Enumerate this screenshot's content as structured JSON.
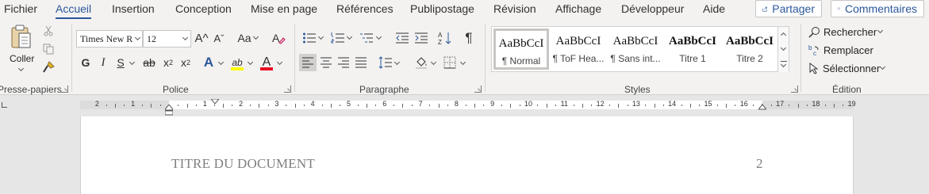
{
  "menu": {
    "tabs": [
      "Fichier",
      "Accueil",
      "Insertion",
      "Conception",
      "Mise en page",
      "Références",
      "Publipostage",
      "Révision",
      "Affichage",
      "Développeur",
      "Aide"
    ],
    "active_tab": "Accueil",
    "share_label": "Partager",
    "comments_label": "Commentaires"
  },
  "clipboard": {
    "paste_label": "Coller",
    "group_label": "Presse-papiers"
  },
  "font": {
    "family": "Times New R",
    "size": "12",
    "group_label": "Police",
    "grow_icon": "A^",
    "shrink_icon": "Aˇ",
    "case_label": "Aa",
    "bold": "G",
    "italic": "I",
    "underline": "S",
    "strike": "ab",
    "subscript": "x",
    "subscript_mark": "2",
    "superscript": "x",
    "superscript_mark": "2",
    "effects": "A",
    "highlight": "ab",
    "color": "A",
    "highlight_color": "#ffff00",
    "font_color": "#e81123"
  },
  "paragraph": {
    "group_label": "Paragraphe",
    "pilcrow": "¶"
  },
  "styles": {
    "group_label": "Styles",
    "items": [
      {
        "preview": "AaBbCcI",
        "name": "¶ Normal"
      },
      {
        "preview": "AaBbCcI",
        "name": "¶ ToF Hea..."
      },
      {
        "preview": "AaBbCcI",
        "name": "¶ Sans int..."
      },
      {
        "preview": "AaBbCcI",
        "name": "Titre 1"
      },
      {
        "preview": "AaBbCcI",
        "name": "Titre 2"
      }
    ]
  },
  "editing": {
    "group_label": "Édition",
    "find_label": "Rechercher",
    "replace_label": "Remplacer",
    "select_label": "Sélectionner"
  },
  "ruler": {
    "numbers": [
      "2",
      "1",
      "1",
      "2",
      "3",
      "4",
      "5",
      "6",
      "7",
      "8",
      "9",
      "10",
      "11",
      "12",
      "13",
      "14",
      "15",
      "16",
      "17",
      "18",
      "19"
    ]
  },
  "document": {
    "header_title": "TITRE DU DOCUMENT",
    "page_number": "2"
  },
  "colors": {
    "accent": "#2b579a",
    "ribbon_bg": "#f3f2f1",
    "canvas_bg": "#e6e6e6"
  }
}
